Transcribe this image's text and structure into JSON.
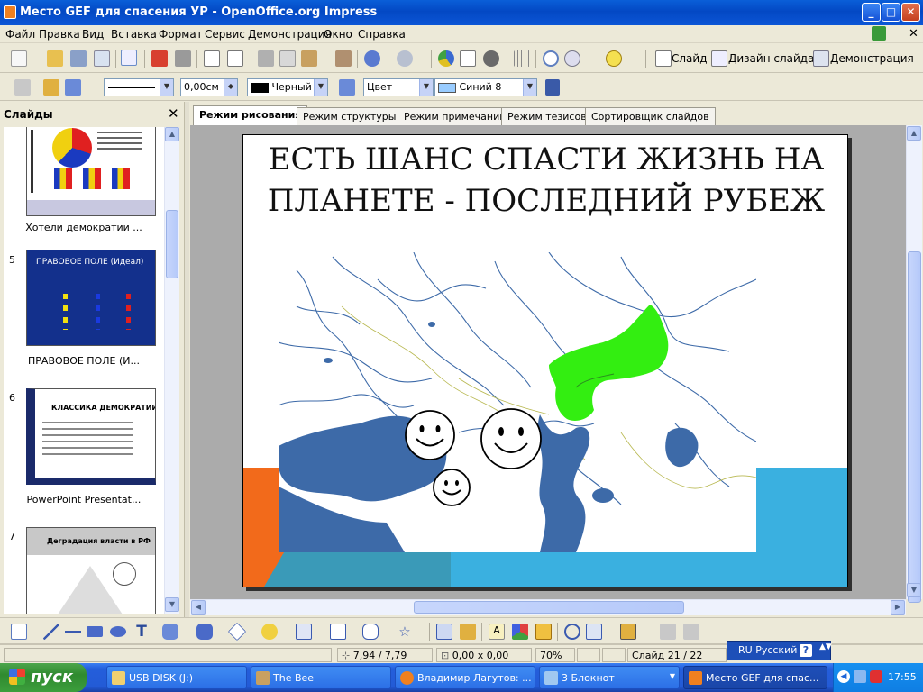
{
  "window": {
    "title": "Место GEF для спасения УР - OpenOffice.org Impress",
    "buttons": {
      "minimize": "_",
      "maximize": "□",
      "close": "✕"
    }
  },
  "menu": [
    "Файл",
    "Правка",
    "Вид",
    "Вставка",
    "Формат",
    "Сервис",
    "Демонстрация",
    "Окно",
    "Справка"
  ],
  "toolbar": {
    "slide_label": "Слайд",
    "design_label": "Дизайн слайда",
    "show_label": "Демонстрация"
  },
  "format_bar": {
    "line_width": "0,00см",
    "line_color": "Черный",
    "area_style": "Цвет",
    "area_color": "Синий 8",
    "colors": {
      "line_color": "#000000",
      "area_color": "#99ccff"
    }
  },
  "slides_panel": {
    "title": "Слайды",
    "close": "✕",
    "items": [
      {
        "number": "",
        "caption": "Хотели демократии ..."
      },
      {
        "number": "5",
        "caption": "ПРАВОВОЕ ПОЛЕ (И..."
      },
      {
        "number": "6",
        "caption": "PowerPoint Presentat..."
      },
      {
        "number": "7",
        "caption": ""
      }
    ],
    "thumb_texts": {
      "t5_title": "ПРАВОВОЕ ПОЛЕ (Идеал)",
      "t6_title": "КЛАССИКА ДЕМОКРАТИИ",
      "t7_title": "Деградация власти в РФ"
    }
  },
  "tabs": [
    "Режим рисования",
    "Режим структуры",
    "Режим примечаний",
    "Режим тезисов",
    "Сортировщик слайдов"
  ],
  "active_tab": 0,
  "slide": {
    "title_line1": "ЕСТЬ ШАНС СПАСТИ  ЖИЗНЬ НА",
    "title_line2": "ПЛАНЕТЕ - ПОСЛЕДНИЙ РУБЕЖ",
    "colors": {
      "orange": "#f26a1b",
      "blue": "#3ab0e0",
      "water": "#3d6aa8",
      "green": "#33ee11"
    }
  },
  "status": {
    "position": "7,94 / 7,79",
    "size": "0,00 x 0,00",
    "zoom": "70%",
    "slide": "Слайд 21 / 22"
  },
  "language": "RU Русский",
  "taskbar": {
    "start": "пуск",
    "tasks": [
      "USB DISK (J:)",
      "The Bee",
      "Владимир Лагутов: ...",
      "3 Блокнот",
      "Место GEF для спас..."
    ],
    "clock": "17:55"
  }
}
